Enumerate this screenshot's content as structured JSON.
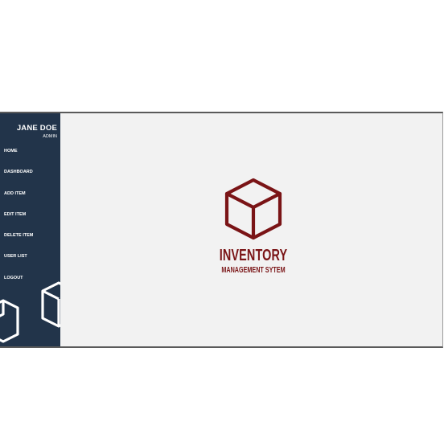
{
  "user": {
    "name": "JANE DOE",
    "role": "ADMIN"
  },
  "menu": {
    "items": [
      {
        "label": "HOME"
      },
      {
        "label": "DASHBOARD"
      },
      {
        "label": "ADD ITEM"
      },
      {
        "label": "EDIT ITEM"
      },
      {
        "label": "DELETE ITEM"
      },
      {
        "label": "USER LIST"
      },
      {
        "label": "LOGOUT"
      }
    ]
  },
  "logo": {
    "icon": "cube-icon",
    "title": "INVENTORY",
    "subtitle": "MANAGEMENT SYTEM"
  },
  "colors": {
    "sidebar_bg": "#22344a",
    "main_bg": "#f2f2f2",
    "brand": "#7a1416"
  }
}
